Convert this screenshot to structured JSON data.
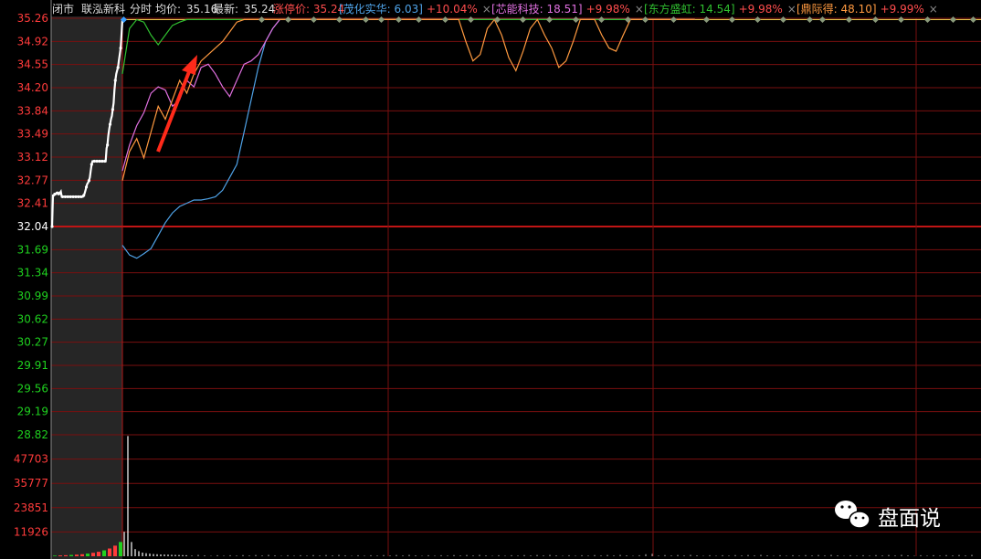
{
  "header": {
    "status": "闭市",
    "stock_name": "联泓新科",
    "mode": "分时",
    "avg_label": "均价:",
    "avg_value": "35.16",
    "latest_label": "最新:",
    "latest_value": "35.24",
    "limit_label": "涨停价:",
    "limit_value": "35.24",
    "compare": [
      {
        "name": "茂化实华",
        "price": "6.03",
        "pct": "+10.04%",
        "color": "#4fa3e8"
      },
      {
        "name": "芯能科技",
        "price": "18.51",
        "pct": "+9.98%",
        "color": "#e070e0"
      },
      {
        "name": "东方盛虹",
        "price": "14.54",
        "pct": "+9.98%",
        "color": "#30c030"
      },
      {
        "name": "鼎际得",
        "price": "48.10",
        "pct": "+9.99%",
        "color": "#ff9a40"
      }
    ],
    "close_glyph": "×"
  },
  "colors": {
    "up": "#ff3b3b",
    "down": "#1fd11f",
    "grid": "#7a0f0f",
    "main_line": "#ffffff",
    "pre_market_bg": "#262626",
    "limit_line": "#e6c14a",
    "arrow": "#ff2a1a"
  },
  "watermark": {
    "text": "盘面说",
    "icon": "wechat-icon"
  },
  "chart_data": {
    "type": "line",
    "prev_close": 32.04,
    "ylim": [
      28.82,
      35.26
    ],
    "price_ticks": [
      "35.26",
      "34.92",
      "34.55",
      "34.20",
      "33.84",
      "33.49",
      "33.12",
      "32.77",
      "32.41",
      "32.04",
      "31.69",
      "31.34",
      "30.99",
      "30.62",
      "30.27",
      "29.91",
      "29.56",
      "29.19",
      "28.82"
    ],
    "volume_ticks": [
      "47703",
      "35777",
      "23851",
      "11926"
    ],
    "volume_ylim": [
      0,
      59629
    ],
    "series": [
      {
        "name": "联泓新科",
        "color": "#ffffff",
        "x": [
          0,
          1,
          2,
          3,
          4,
          5,
          6,
          7,
          8,
          9,
          10,
          11,
          12,
          13,
          14,
          15,
          16,
          17,
          18,
          19,
          20,
          21,
          22,
          23,
          24,
          25,
          26,
          27,
          28,
          29,
          30,
          31,
          32,
          33,
          34,
          35,
          36,
          37,
          38,
          39,
          40,
          41,
          42,
          43,
          44,
          45,
          46,
          47,
          48,
          49,
          50,
          51,
          52,
          53,
          54,
          55,
          56,
          57,
          58,
          59,
          60,
          61,
          62,
          63,
          64,
          65,
          66,
          67,
          68,
          69,
          70,
          71,
          72,
          73,
          74,
          75,
          76,
          77,
          78,
          79,
          80
        ],
        "y": [
          32.04,
          32.52,
          32.52,
          32.54,
          32.54,
          32.56,
          32.56,
          32.54,
          32.54,
          32.56,
          32.58,
          32.5,
          32.5,
          32.5,
          32.5,
          32.5,
          32.5,
          32.5,
          32.5,
          32.5,
          32.5,
          32.5,
          32.5,
          32.5,
          32.5,
          32.5,
          32.5,
          32.5,
          32.5,
          32.5,
          32.5,
          32.5,
          32.5,
          32.5,
          32.5,
          32.5,
          32.52,
          32.55,
          32.6,
          32.65,
          32.7,
          32.72,
          32.75,
          32.8,
          32.9,
          33.0,
          33.05,
          33.05,
          33.05,
          33.05,
          33.05,
          33.05,
          33.05,
          33.05,
          33.05,
          33.05,
          33.05,
          33.05,
          33.05,
          33.05,
          33.05,
          33.05,
          33.25,
          33.3,
          33.45,
          33.55,
          33.62,
          33.7,
          33.75,
          33.85,
          33.95,
          34.15,
          34.3,
          34.4,
          34.45,
          34.5,
          34.6,
          34.7,
          34.8,
          35.0,
          35.24
        ]
      },
      {
        "name": "茂化实华",
        "color": "#4fa3e8",
        "x": [
          80,
          82,
          84,
          86,
          88,
          90,
          92,
          94,
          96,
          98,
          100,
          102,
          104,
          106,
          108,
          110,
          112,
          114,
          116,
          118,
          120,
          122,
          124,
          126,
          128,
          130,
          132,
          134,
          136,
          138,
          140,
          142,
          144,
          146,
          148,
          150,
          152,
          154,
          156,
          158,
          160,
          162,
          164,
          166,
          168,
          170,
          172,
          174,
          176,
          178,
          180,
          182,
          184,
          186,
          188,
          190,
          192,
          194,
          196,
          198,
          200,
          202,
          204,
          206,
          208,
          210,
          212,
          214,
          216,
          218,
          220,
          222,
          224,
          226,
          228,
          230,
          232,
          234,
          236,
          238,
          240
        ],
        "y": [
          31.75,
          31.6,
          31.55,
          31.62,
          31.7,
          31.9,
          32.1,
          32.25,
          32.35,
          32.4,
          32.45,
          32.45,
          32.47,
          32.5,
          32.6,
          32.8,
          33.0,
          33.5,
          34.0,
          34.5,
          34.9,
          35.1,
          35.24,
          35.24,
          35.24,
          35.24,
          35.24,
          35.24,
          35.24,
          35.24,
          35.24,
          35.24,
          35.24,
          35.24,
          35.24,
          35.24,
          35.24,
          35.24,
          35.24,
          35.24,
          35.24,
          35.24,
          35.24,
          35.24,
          35.24,
          35.24,
          35.24,
          35.24,
          35.24,
          35.24,
          35.24,
          35.24,
          35.24,
          35.24,
          35.24,
          35.24,
          35.24,
          35.24,
          35.24,
          35.24,
          35.24,
          35.24,
          35.24,
          35.24,
          35.24,
          35.24,
          35.24,
          35.24,
          35.24,
          35.24,
          35.24,
          35.24,
          35.24,
          35.24,
          35.24,
          35.24,
          35.24,
          35.24,
          35.24,
          35.24,
          35.24
        ]
      },
      {
        "name": "芯能科技",
        "color": "#e070e0",
        "x": [
          80,
          82,
          84,
          86,
          88,
          90,
          92,
          94,
          96,
          98,
          100,
          102,
          104,
          106,
          108,
          110,
          112,
          114,
          116,
          118,
          120,
          122,
          124,
          126,
          128,
          130,
          132,
          134,
          136,
          138,
          140,
          142,
          144,
          146,
          148,
          150,
          152,
          154,
          156,
          158,
          160,
          162,
          164,
          166,
          168,
          170,
          172,
          174,
          176,
          178,
          180,
          182,
          184,
          186,
          188,
          190,
          192,
          194,
          196,
          198,
          200,
          202,
          204,
          206,
          208,
          210,
          212,
          214,
          216,
          218,
          220,
          222,
          224,
          226,
          228,
          230,
          232,
          234,
          236,
          238,
          240
        ],
        "y": [
          32.9,
          33.3,
          33.6,
          33.8,
          34.1,
          34.2,
          34.15,
          33.9,
          34.0,
          34.3,
          34.2,
          34.5,
          34.55,
          34.4,
          34.2,
          34.05,
          34.3,
          34.55,
          34.6,
          34.7,
          34.9,
          35.1,
          35.24,
          35.24,
          35.24,
          35.24,
          35.24,
          35.24,
          35.24,
          35.24,
          35.24,
          35.24,
          35.24,
          35.24,
          35.24,
          35.24,
          35.24,
          35.24,
          35.24,
          35.24,
          35.24,
          35.24,
          35.24,
          35.24,
          35.24,
          35.24,
          35.24,
          35.24,
          35.24,
          35.24,
          35.24,
          35.24,
          35.24,
          35.24,
          35.24,
          35.24,
          35.24,
          35.24,
          35.24,
          35.24,
          35.24,
          35.24,
          35.24,
          35.24,
          35.24,
          35.24,
          35.24,
          35.24,
          35.24,
          35.24,
          35.24,
          35.24,
          35.24,
          35.24,
          35.24,
          35.24,
          35.24,
          35.24,
          35.24,
          35.24,
          35.24
        ]
      },
      {
        "name": "东方盛虹",
        "color": "#30c030",
        "x": [
          80,
          82,
          84,
          86,
          88,
          90,
          92,
          94,
          96,
          98,
          100,
          102,
          104,
          106,
          108,
          110,
          112,
          114,
          116,
          118,
          120,
          122,
          124,
          126,
          128,
          130,
          132,
          134,
          136,
          138,
          140,
          142,
          144,
          146,
          148,
          150,
          152,
          154,
          156,
          158,
          160,
          162,
          164,
          166,
          168,
          170,
          172,
          174,
          176,
          178,
          180,
          182,
          184,
          186,
          188,
          190,
          192,
          194,
          196,
          198,
          200,
          202,
          204,
          206,
          208,
          210,
          212,
          214,
          216,
          218,
          220,
          222,
          224,
          226,
          228,
          230,
          232,
          234,
          236,
          238,
          240
        ],
        "y": [
          34.4,
          35.1,
          35.24,
          35.2,
          35.0,
          34.85,
          35.0,
          35.15,
          35.2,
          35.24,
          35.24,
          35.24,
          35.24,
          35.24,
          35.24,
          35.24,
          35.24,
          35.24,
          35.24,
          35.24,
          35.24,
          35.24,
          35.24,
          35.24,
          35.24,
          35.24,
          35.24,
          35.24,
          35.24,
          35.24,
          35.24,
          35.24,
          35.24,
          35.24,
          35.24,
          35.24,
          35.24,
          35.24,
          35.24,
          35.24,
          35.24,
          35.24,
          35.24,
          35.24,
          35.24,
          35.24,
          35.24,
          35.24,
          35.24,
          35.24,
          35.24,
          35.24,
          35.24,
          35.24,
          35.24,
          35.24,
          35.24,
          35.24,
          35.24,
          35.24,
          35.24,
          35.24,
          35.24,
          35.24,
          35.24,
          35.24,
          35.24,
          35.24,
          35.24,
          35.24,
          35.24,
          35.24,
          35.24,
          35.24,
          35.24,
          35.24,
          35.24,
          35.24,
          35.24,
          35.24,
          35.24
        ]
      },
      {
        "name": "鼎际得",
        "color": "#ff9a40",
        "x": [
          80,
          82,
          84,
          86,
          88,
          90,
          92,
          94,
          96,
          98,
          100,
          102,
          104,
          106,
          108,
          110,
          112,
          114,
          116,
          118,
          120,
          122,
          124,
          126,
          128,
          130,
          132,
          134,
          136,
          138,
          140,
          142,
          144,
          146,
          148,
          150,
          152,
          154,
          156,
          158,
          160,
          162,
          164,
          166,
          168,
          170,
          172,
          174,
          176,
          178,
          180,
          182,
          184,
          186,
          188,
          190,
          192,
          194,
          196,
          198,
          200,
          202,
          204,
          206,
          208,
          210,
          212,
          214,
          216,
          218,
          220,
          222,
          224,
          226,
          228,
          230,
          232,
          234,
          236,
          238,
          240
        ],
        "y": [
          32.75,
          33.2,
          33.4,
          33.1,
          33.5,
          33.9,
          33.7,
          34.0,
          34.3,
          34.1,
          34.4,
          34.6,
          34.7,
          34.8,
          34.9,
          35.05,
          35.2,
          35.24,
          35.24,
          35.24,
          35.24,
          35.24,
          35.24,
          35.24,
          35.24,
          35.24,
          35.24,
          35.24,
          35.24,
          35.24,
          35.24,
          35.24,
          35.24,
          35.24,
          35.24,
          35.24,
          35.24,
          35.24,
          35.24,
          35.24,
          35.24,
          35.24,
          35.24,
          35.24,
          35.24,
          35.24,
          35.24,
          35.24,
          34.9,
          34.6,
          34.7,
          35.1,
          35.24,
          35.0,
          34.65,
          34.45,
          34.75,
          35.1,
          35.24,
          35.0,
          34.8,
          34.5,
          34.6,
          34.9,
          35.24,
          35.24,
          35.24,
          35.0,
          34.8,
          34.75,
          35.0,
          35.24,
          35.24,
          35.24,
          35.24,
          35.24,
          35.24,
          35.24,
          35.24,
          35.24,
          35.24
        ]
      }
    ]
  }
}
